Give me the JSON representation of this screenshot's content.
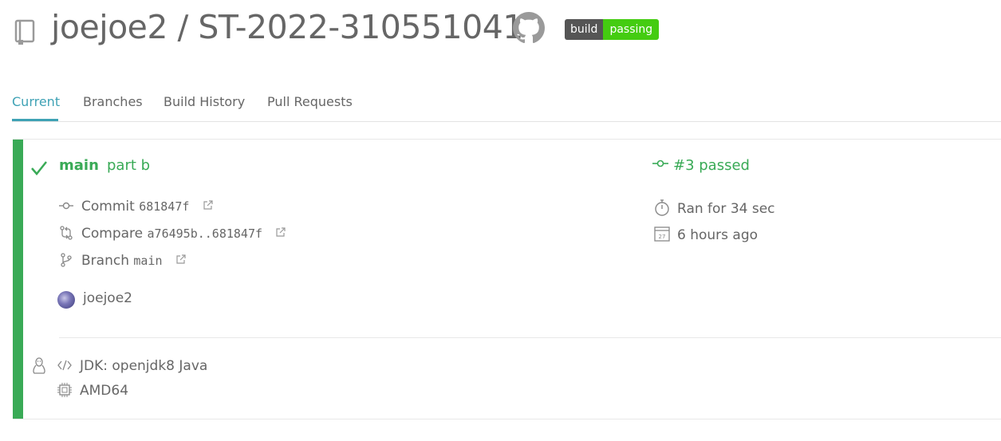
{
  "header": {
    "owner": "joejoe2",
    "separator": " / ",
    "repo": "ST-2022-310551041",
    "badge": {
      "left": "build",
      "right": "passing",
      "color": "#44cc11"
    }
  },
  "tabs": [
    {
      "label": "Current",
      "active": true
    },
    {
      "label": "Branches",
      "active": false
    },
    {
      "label": "Build History",
      "active": false
    },
    {
      "label": "Pull Requests",
      "active": false
    }
  ],
  "build": {
    "state_color": "#39aa56",
    "branch": "main",
    "message": "part b",
    "commit": {
      "label": "Commit",
      "sha": "681847f"
    },
    "compare": {
      "label": "Compare",
      "range": "a76495b..681847f"
    },
    "branch_link": {
      "label": "Branch",
      "name": "main"
    },
    "author": "joejoe2",
    "status": "#3 passed",
    "duration": "Ran for 34 sec",
    "finished": "6 hours ago",
    "job": {
      "os_icon": "linux-icon",
      "language": "JDK: openjdk8 Java",
      "arch": "AMD64"
    }
  }
}
